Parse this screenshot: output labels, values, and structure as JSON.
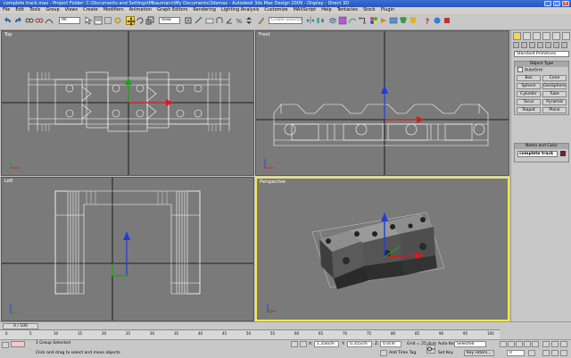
{
  "window": {
    "title": "complete track.max     - Project Folder: C:\\Documents and Settings\\Mbaumann\\My Documents\\3dsmax     - Autodesk 3ds Max Design 2009     - Display : Direct 3D"
  },
  "menu": [
    "File",
    "Edit",
    "Tools",
    "Group",
    "Views",
    "Create",
    "Modifiers",
    "Animation",
    "Graph Editors",
    "Rendering",
    "Lighting Analysis",
    "Customize",
    "MAXScript",
    "Help",
    "Tentacles",
    "Stock",
    "Plugin"
  ],
  "toolbar": {
    "filter_value": "All",
    "view_value": "View",
    "selection_set_placeholder": "Create Selection Set"
  },
  "viewports": {
    "top_label": "Top",
    "front_label": "Front",
    "left_label": "Left",
    "perspective_label": "Perspective"
  },
  "command_panel": {
    "category": "Standard Primitives",
    "object_type_header": "Object Type",
    "autogrid": "AutoGrid",
    "buttons": [
      "Box",
      "Cone",
      "Sphere",
      "GeoSphere",
      "Cylinder",
      "Tube",
      "Torus",
      "Pyramid",
      "Teapot",
      "Plane"
    ],
    "name_color_header": "Name and Color",
    "object_name": "complete track"
  },
  "timeline": {
    "frame": "0 / 100",
    "ticks": [
      "0",
      "5",
      "10",
      "15",
      "20",
      "25",
      "30",
      "35",
      "40",
      "45",
      "50",
      "55",
      "60",
      "65",
      "70",
      "75",
      "80",
      "85",
      "90",
      "95",
      "100"
    ]
  },
  "status": {
    "selection": "1 Group Selected",
    "prompt": "Click and drag to select and move objects",
    "x_label": "X:",
    "x_value": "1.356cm",
    "y_label": "Y:",
    "y_value": "0.355cm",
    "z_label": "Z:",
    "z_value": "0.0cm",
    "grid": "Grid = 25.4cm",
    "add_time_tag": "Add Time Tag",
    "auto_key": "Auto Key",
    "auto_key_mode": "Selected",
    "set_key": "Set Key",
    "key_filters": "Key Filters...",
    "frame_value": "0"
  }
}
